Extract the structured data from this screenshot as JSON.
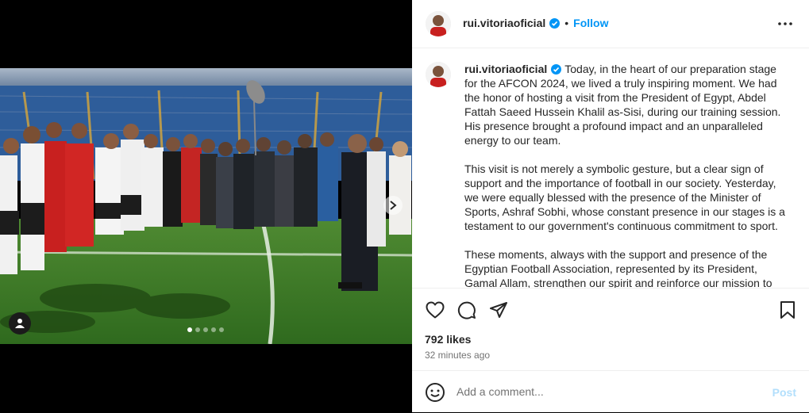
{
  "post": {
    "username": "rui.vitoriaoficial",
    "follow_label": "Follow",
    "separator": "•",
    "caption_paragraphs": [
      "Today, in the heart of our preparation stage for the AFCON 2024, we lived a truly inspiring moment. We had the honor of hosting a visit from the President of Egypt, Abdel Fattah Saeed Hussein Khalil as-Sisi, during our training session. His presence brought a profound impact and an unparalleled energy to our team.",
      "This visit is not merely a symbolic gesture, but a clear sign of support and the importance of football in our society. Yesterday, we were equally blessed with the presence of the Minister of Sports, Ashraf Sobhi, whose constant presence in our stages is a testament to our government's continuous commitment to sport.",
      "These moments, always with the support and presence of the Egyptian Football Association, represented by its President, Gamal Allam, strengthen our spirit and reinforce our mission to"
    ],
    "likes": "792 likes",
    "time_ago": "32 minutes ago"
  },
  "comment": {
    "placeholder": "Add a comment...",
    "post_label": "Post"
  },
  "carousel": {
    "total_slides": 5,
    "active_slide": 1
  },
  "colors": {
    "accent": "#0095f6",
    "verified": "#0095f6",
    "post_disabled": "#b2dffc"
  }
}
